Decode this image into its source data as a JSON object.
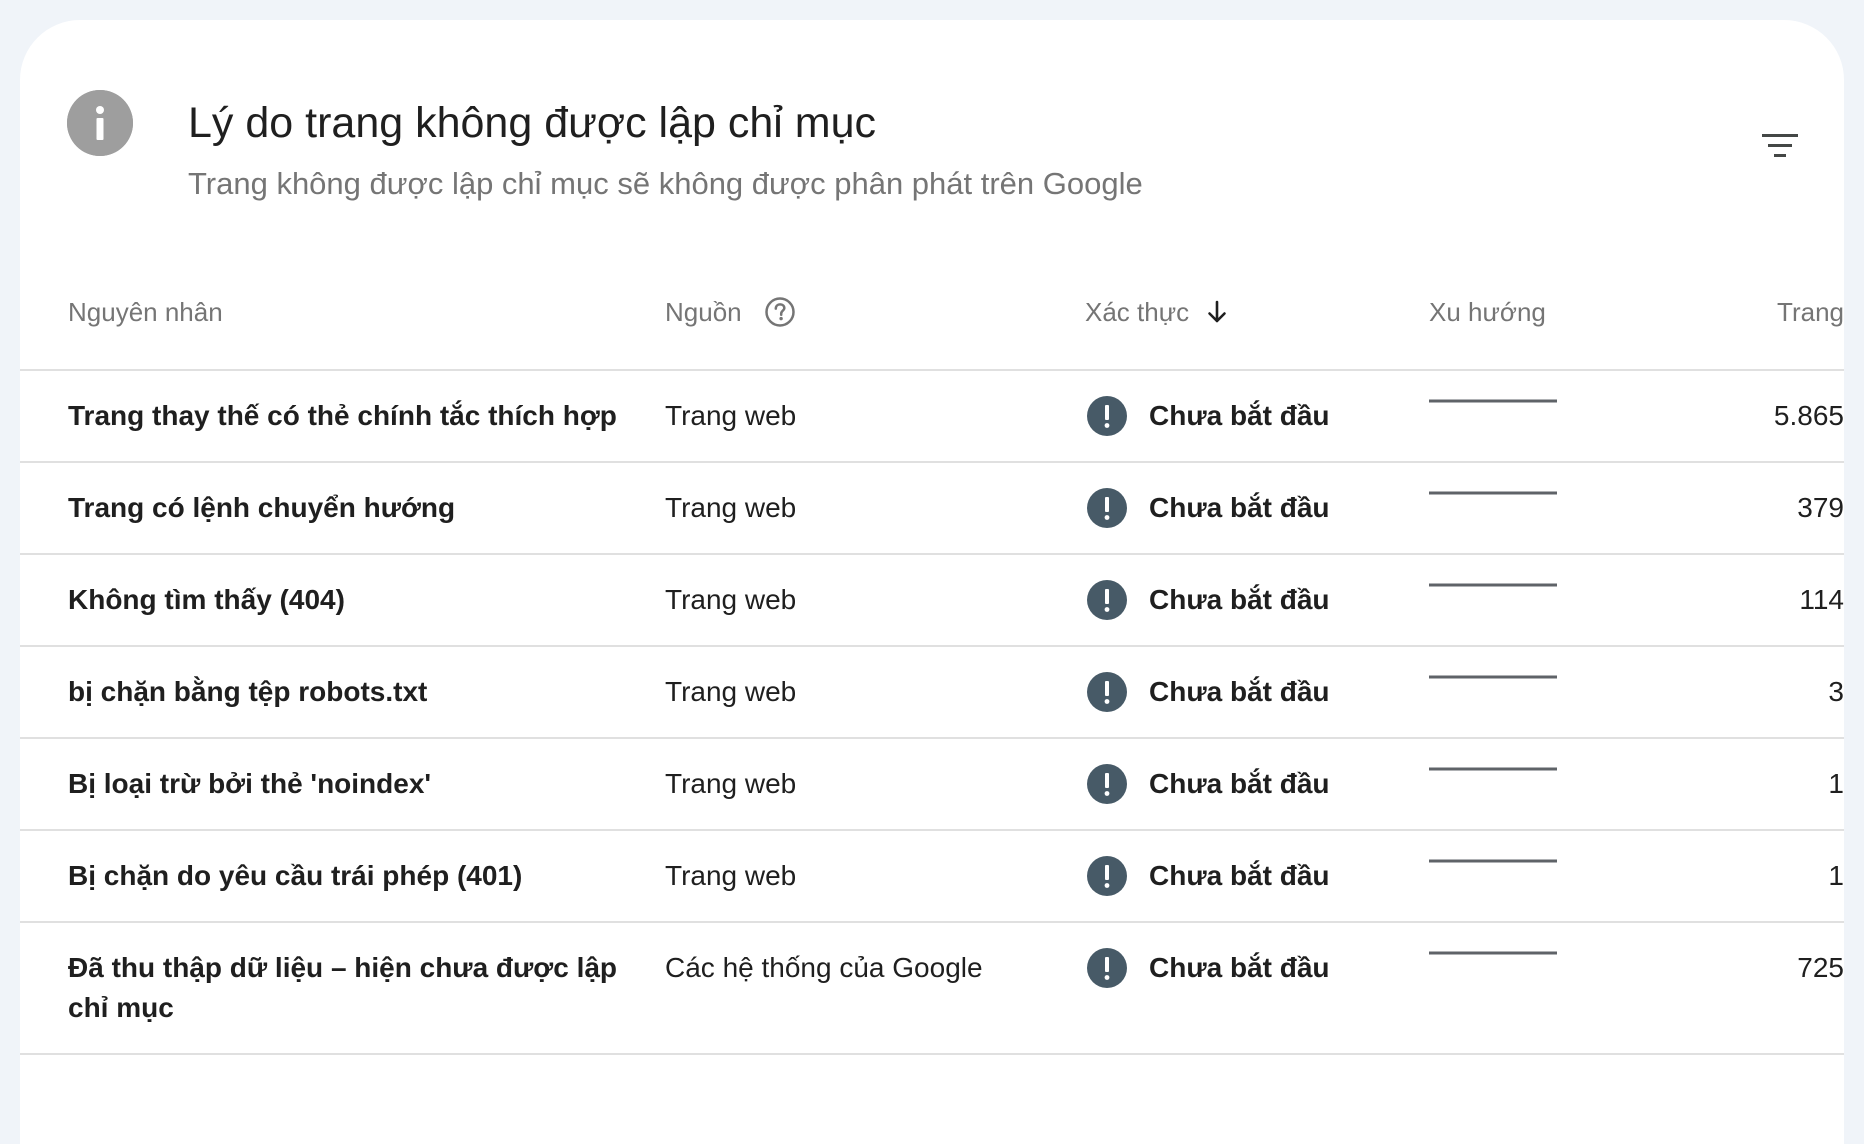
{
  "card": {
    "title": "Lý do trang không được lập chỉ mục",
    "subtitle": "Trang không được lập chỉ mục sẽ không được phân phát trên Google",
    "icons": {
      "header": "info-icon",
      "filter": "filter-icon"
    }
  },
  "table": {
    "headers": {
      "reason": "Nguyên nhân",
      "source": "Nguồn",
      "validation": "Xác thực",
      "trend": "Xu hướng",
      "pages": "Trang"
    },
    "header_icons": {
      "source": "help-icon",
      "validation": "arrow-down-icon"
    },
    "status_icon": "warning-icon",
    "status_color": "#475a67",
    "rows": [
      {
        "reason": "Trang thay thế có thẻ chính tắc thích hợp",
        "source": "Trang web",
        "status": "Chưa bắt đầu",
        "pages": "5.865"
      },
      {
        "reason": "Trang có lệnh chuyển hướng",
        "source": "Trang web",
        "status": "Chưa bắt đầu",
        "pages": "379"
      },
      {
        "reason": "Không tìm thấy (404)",
        "source": "Trang web",
        "status": "Chưa bắt đầu",
        "pages": "114"
      },
      {
        "reason": "bị chặn bằng tệp robots.txt",
        "source": "Trang web",
        "status": "Chưa bắt đầu",
        "pages": "3"
      },
      {
        "reason": "Bị loại trừ bởi thẻ 'noindex'",
        "source": "Trang web",
        "status": "Chưa bắt đầu",
        "pages": "1"
      },
      {
        "reason": "Bị chặn do yêu cầu trái phép (401)",
        "source": "Trang web",
        "status": "Chưa bắt đầu",
        "pages": "1"
      },
      {
        "reason": "Đã thu thập dữ liệu – hiện chưa được lập chỉ mục",
        "source": "Các hệ thống của Google",
        "status": "Chưa bắt đầu",
        "pages": "725"
      }
    ]
  }
}
